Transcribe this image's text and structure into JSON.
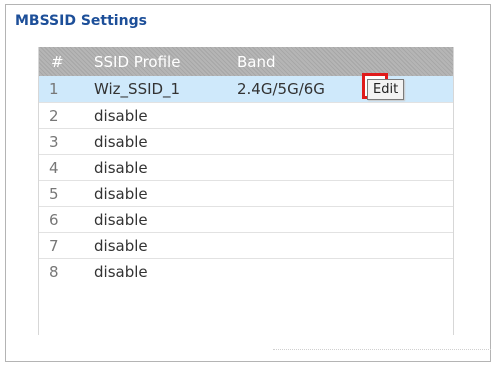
{
  "panel": {
    "title": "MBSSID Settings"
  },
  "table": {
    "columns": [
      "#",
      "SSID Profile",
      "Band"
    ],
    "rows": [
      {
        "num": "1",
        "name": "Wiz_SSID_1",
        "band": "2.4G/5G/6G",
        "selected": true
      },
      {
        "num": "2",
        "name": "disable",
        "band": ""
      },
      {
        "num": "3",
        "name": "disable",
        "band": ""
      },
      {
        "num": "4",
        "name": "disable",
        "band": ""
      },
      {
        "num": "5",
        "name": "disable",
        "band": ""
      },
      {
        "num": "6",
        "name": "disable",
        "band": ""
      },
      {
        "num": "7",
        "name": "disable",
        "band": ""
      },
      {
        "num": "8",
        "name": "disable",
        "band": ""
      }
    ]
  },
  "tooltip": {
    "text": "Edit"
  },
  "icons": {
    "edit": "edit-icon"
  },
  "colors": {
    "title": "#1d4f99",
    "selected_row": "#cfe9fb",
    "highlight_border": "#e01b1b"
  }
}
